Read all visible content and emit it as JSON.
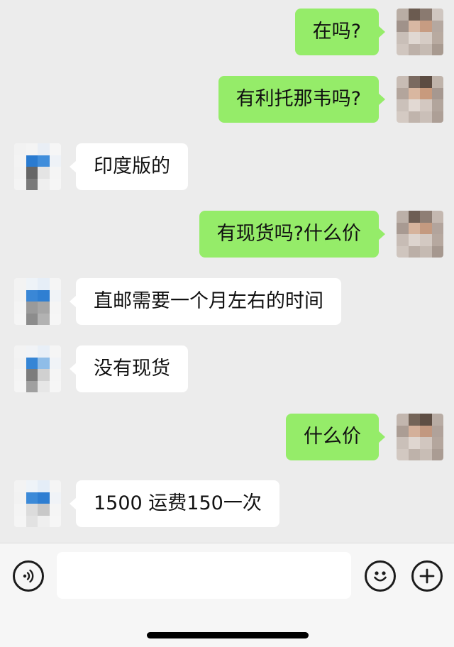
{
  "messages": [
    {
      "id": "m1",
      "side": "out",
      "text": "在吗?"
    },
    {
      "id": "m2",
      "side": "out",
      "text": "有利托那韦吗?"
    },
    {
      "id": "m3",
      "side": "in",
      "text": "印度版的"
    },
    {
      "id": "m4",
      "side": "out",
      "text": "有现货吗?什么价"
    },
    {
      "id": "m5",
      "side": "in",
      "text": "直邮需要一个月左右的时间"
    },
    {
      "id": "m6",
      "side": "in",
      "text": "没有现货"
    },
    {
      "id": "m7",
      "side": "out",
      "text": "什么价"
    },
    {
      "id": "m8",
      "side": "in",
      "text": "1500 运费150一次"
    }
  ],
  "input_bar": {
    "placeholder": "",
    "voice_icon": "voice-icon",
    "emoji_icon": "emoji-icon",
    "add_icon": "plus-icon"
  },
  "colors": {
    "background": "#ececec",
    "outgoing_bubble": "#95ec69",
    "incoming_bubble": "#ffffff"
  }
}
